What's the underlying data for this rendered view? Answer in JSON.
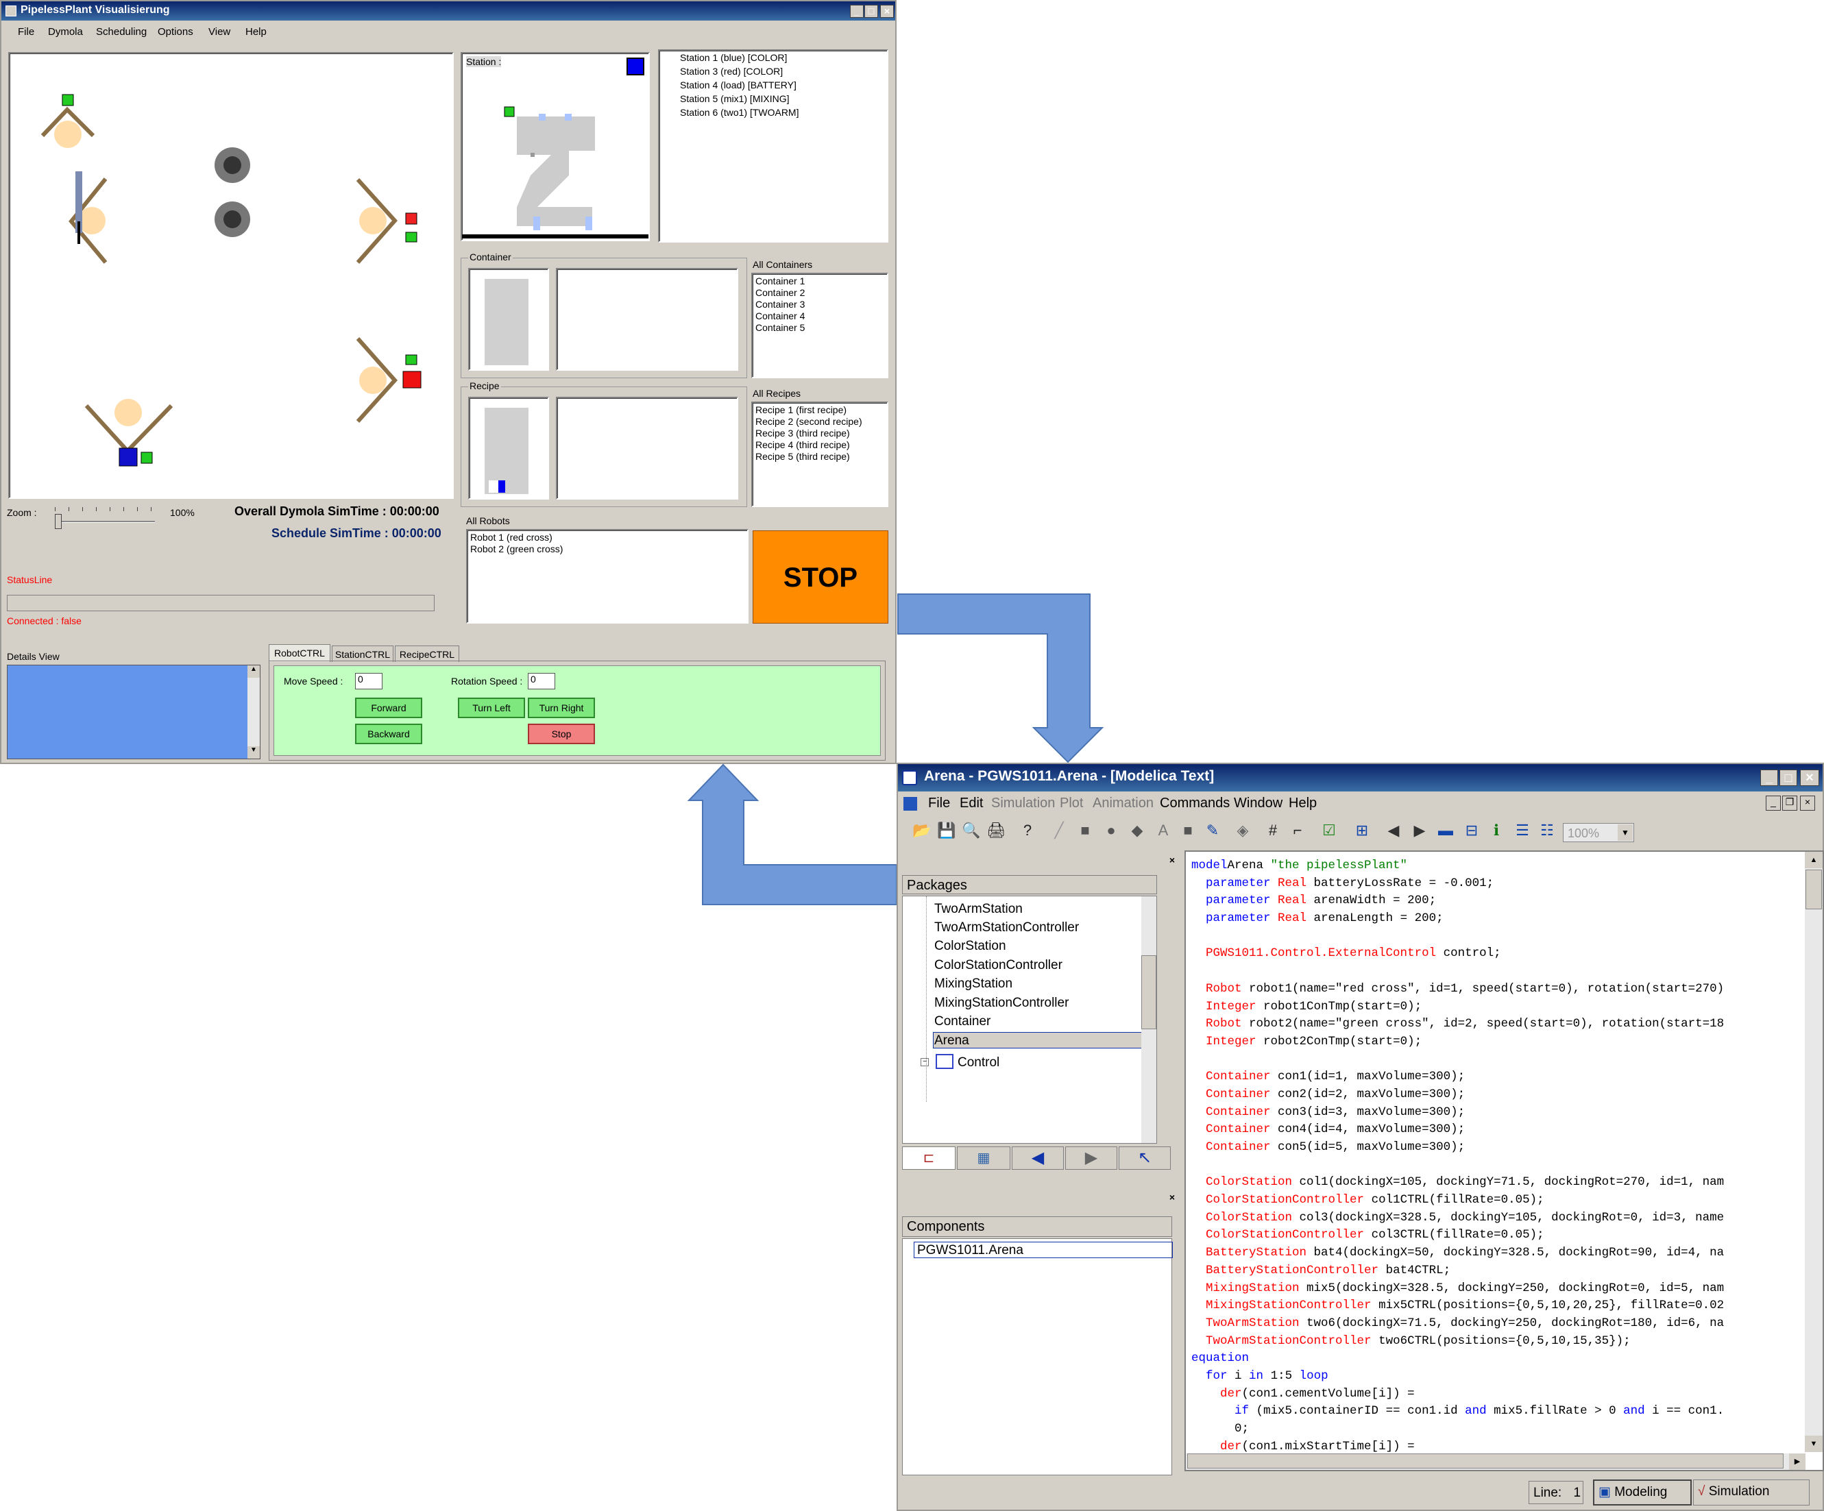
{
  "pipeless": {
    "title": "PipelessPlant Visualisierung",
    "menu": [
      "File",
      "Dymola",
      "Scheduling",
      "Options",
      "View",
      "Help"
    ],
    "station_label": "Station :",
    "stations": [
      "Station 1 (blue) [COLOR]",
      "Station 3 (red) [COLOR]",
      "Station 4 (load) [BATTERY]",
      "Station 5 (mix1) [MIXING]",
      "Station 6 (two1) [TWOARM]"
    ],
    "container_label": "Container",
    "all_containers_label": "All Containers",
    "containers": [
      "Container 1",
      "Container 2",
      "Container 3",
      "Container 4",
      "Container 5"
    ],
    "recipe_label": "Recipe",
    "all_recipes_label": "All Recipes",
    "recipes": [
      "Recipe 1 (first recipe)",
      "Recipe 2 (second recipe)",
      "Recipe 3 (third recipe)",
      "Recipe 4 (third recipe)",
      "Recipe 5 (third recipe)"
    ],
    "all_robots_label": "All Robots",
    "robots": [
      "Robot 1 (red cross)",
      "Robot 2 (green cross)"
    ],
    "stop_label": "STOP",
    "zoom_label": "Zoom :",
    "zoom_value": "100%",
    "zoom_level": 0,
    "overall_simtime": "Overall Dymola SimTime : 00:00:00",
    "schedule_simtime": "Schedule SimTime : 00:00:00",
    "status_line": "StatusLine",
    "connected": "Connected : false",
    "details_view": "Details View",
    "tabs": [
      "RobotCTRL",
      "StationCTRL",
      "RecipeCTRL"
    ],
    "move_speed_label": "Move Speed :",
    "move_speed_value": "0",
    "rotation_speed_label": "Rotation Speed :",
    "rotation_speed_value": "0",
    "btn_forward": "Forward",
    "btn_backward": "Backward",
    "btn_turn_left": "Turn Left",
    "btn_turn_right": "Turn Right",
    "btn_stop": "Stop",
    "colors": {
      "stop_orange": "#ff8c00",
      "panel_green": "#c0ffc0",
      "details_blue": "#6495ed",
      "status_red": "#ff0000",
      "label_navy": "#0a246a"
    }
  },
  "dymola": {
    "title": "Arena - PGWS1011.Arena  - [Modelica Text]",
    "menu": [
      "File",
      "Edit",
      "Simulation",
      "Plot",
      "Animation",
      "Commands",
      "Window",
      "Help"
    ],
    "zoom": "100%",
    "packages_header": "Packages",
    "packages": [
      "TwoArmStation",
      "TwoArmStationController",
      "ColorStation",
      "ColorStationController",
      "MixingStation",
      "MixingStationController",
      "Container",
      "Arena"
    ],
    "package_sub": "Control",
    "components_header": "Components",
    "component_item": "PGWS1011.Arena",
    "status_line_label": "Line:",
    "status_line_value": "1",
    "mode_modeling": "Modeling",
    "mode_simulation": "Simulation",
    "code_lines": [
      [
        [
          "kw",
          "model"
        ],
        [
          "",
          "Arena "
        ],
        [
          "str",
          "\"the pipelessPlant\""
        ]
      ],
      [
        [
          "",
          "  "
        ],
        [
          "kw",
          "parameter"
        ],
        [
          "",
          ""
        ],
        [
          "ty",
          " Real"
        ],
        [
          "",
          " batteryLossRate = -0.001;"
        ]
      ],
      [
        [
          "",
          "  "
        ],
        [
          "kw",
          "parameter"
        ],
        [
          "ty",
          " Real"
        ],
        [
          "",
          " arenaWidth = 200;"
        ]
      ],
      [
        [
          "",
          "  "
        ],
        [
          "kw",
          "parameter"
        ],
        [
          "ty",
          " Real"
        ],
        [
          "",
          " arenaLength = 200;"
        ]
      ],
      [],
      [
        [
          "",
          "  "
        ],
        [
          "ty",
          "PGWS1011.Control.ExternalControl"
        ],
        [
          "",
          " control;"
        ]
      ],
      [],
      [
        [
          "",
          "  "
        ],
        [
          "ty",
          "Robot"
        ],
        [
          "",
          " robot1(name=\"red cross\", id=1, speed(start=0), rotation(start=270)"
        ]
      ],
      [
        [
          "",
          "  "
        ],
        [
          "ty",
          "Integer"
        ],
        [
          "",
          " robot1ConTmp(start=0);"
        ]
      ],
      [
        [
          "",
          "  "
        ],
        [
          "ty",
          "Robot"
        ],
        [
          "",
          " robot2(name=\"green cross\", id=2, speed(start=0), rotation(start=18"
        ]
      ],
      [
        [
          "",
          "  "
        ],
        [
          "ty",
          "Integer"
        ],
        [
          "",
          " robot2ConTmp(start=0);"
        ]
      ],
      [],
      [
        [
          "",
          "  "
        ],
        [
          "ty",
          "Container"
        ],
        [
          "",
          " con1(id=1, maxVolume=300);"
        ]
      ],
      [
        [
          "",
          "  "
        ],
        [
          "ty",
          "Container"
        ],
        [
          "",
          " con2(id=2, maxVolume=300);"
        ]
      ],
      [
        [
          "",
          "  "
        ],
        [
          "ty",
          "Container"
        ],
        [
          "",
          " con3(id=3, maxVolume=300);"
        ]
      ],
      [
        [
          "",
          "  "
        ],
        [
          "ty",
          "Container"
        ],
        [
          "",
          " con4(id=4, maxVolume=300);"
        ]
      ],
      [
        [
          "",
          "  "
        ],
        [
          "ty",
          "Container"
        ],
        [
          "",
          " con5(id=5, maxVolume=300);"
        ]
      ],
      [],
      [
        [
          "",
          "  "
        ],
        [
          "ty",
          "ColorStation"
        ],
        [
          "",
          " col1(dockingX=105, dockingY=71.5, dockingRot=270, id=1, nam"
        ]
      ],
      [
        [
          "",
          "  "
        ],
        [
          "ty",
          "ColorStationController"
        ],
        [
          "",
          " col1CTRL(fillRate=0.05);"
        ]
      ],
      [
        [
          "",
          "  "
        ],
        [
          "ty",
          "ColorStation"
        ],
        [
          "",
          " col3(dockingX=328.5, dockingY=105, dockingRot=0, id=3, name"
        ]
      ],
      [
        [
          "",
          "  "
        ],
        [
          "ty",
          "ColorStationController"
        ],
        [
          "",
          " col3CTRL(fillRate=0.05);"
        ]
      ],
      [
        [
          "",
          "  "
        ],
        [
          "ty",
          "BatteryStation"
        ],
        [
          "",
          " bat4(dockingX=50, dockingY=328.5, dockingRot=90, id=4, na"
        ]
      ],
      [
        [
          "",
          "  "
        ],
        [
          "ty",
          "BatteryStationController"
        ],
        [
          "",
          " bat4CTRL;"
        ]
      ],
      [
        [
          "",
          "  "
        ],
        [
          "ty",
          "MixingStation"
        ],
        [
          "",
          " mix5(dockingX=328.5, dockingY=250, dockingRot=0, id=5, nam"
        ]
      ],
      [
        [
          "",
          "  "
        ],
        [
          "ty",
          "MixingStationController"
        ],
        [
          "",
          " mix5CTRL(positions={0,5,10,20,25}, fillRate=0.02"
        ]
      ],
      [
        [
          "",
          "  "
        ],
        [
          "ty",
          "TwoArmStation"
        ],
        [
          "",
          " two6(dockingX=71.5, dockingY=250, dockingRot=180, id=6, na"
        ]
      ],
      [
        [
          "",
          "  "
        ],
        [
          "ty",
          "TwoArmStationController"
        ],
        [
          "",
          " two6CTRL(positions={0,5,10,15,35});"
        ]
      ],
      [
        [
          "kw",
          "equation"
        ]
      ],
      [
        [
          "",
          "  "
        ],
        [
          "kw",
          "for"
        ],
        [
          "",
          " i "
        ],
        [
          "kw",
          "in"
        ],
        [
          "",
          " 1:5 "
        ],
        [
          "kw",
          "loop"
        ]
      ],
      [
        [
          "",
          "    "
        ],
        [
          "ty",
          "der"
        ],
        [
          "",
          "(con1.cementVolume[i]) ="
        ]
      ],
      [
        [
          "",
          "      "
        ],
        [
          "kw",
          "if"
        ],
        [
          "",
          " (mix5.containerID == con1.id "
        ],
        [
          "kw",
          "and"
        ],
        [
          "",
          " mix5.fillRate > 0 "
        ],
        [
          "kw",
          "and"
        ],
        [
          "",
          " i == con1."
        ]
      ],
      [
        [
          "",
          "      0;"
        ]
      ],
      [
        [
          "",
          "    "
        ],
        [
          "ty",
          "der"
        ],
        [
          "",
          "(con1.mixStartTime[i]) ="
        ]
      ]
    ]
  }
}
